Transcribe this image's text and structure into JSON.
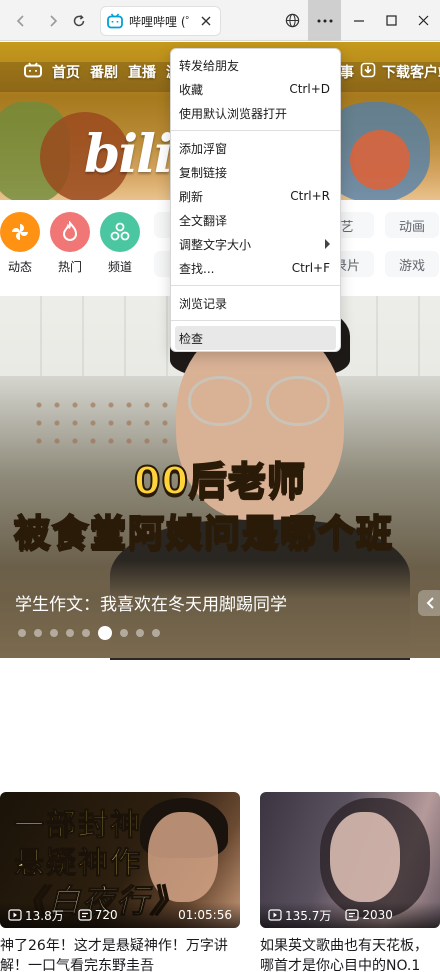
{
  "browser": {
    "tab_title": "哔哩哔哩 (゜-゜)つロ",
    "brand_color": "#00a1d6",
    "back_icon": "back-arrow-icon",
    "forward_icon": "forward-arrow-icon",
    "reload_icon": "reload-icon",
    "close_icon": "close-icon",
    "globe_icon": "globe-icon",
    "more_icon": "more-dots-icon",
    "min_icon": "minimize-icon",
    "max_icon": "maximize-icon",
    "window_close_icon": "window-close-icon"
  },
  "top_nav": {
    "items": [
      "首页",
      "番剧",
      "直播",
      "游"
    ],
    "right_partial": "事",
    "download_label": "下载客户端"
  },
  "categories": [
    {
      "label": "动态",
      "color": "#ff9212",
      "icon": "pinwheel-icon"
    },
    {
      "label": "热门",
      "color": "#f07775",
      "icon": "flame-icon"
    },
    {
      "label": "频道",
      "color": "#4ac6a0",
      "icon": "channel-icon"
    }
  ],
  "pills": {
    "row1": [
      "艺",
      "动画"
    ],
    "row2": [
      "录片",
      "游戏"
    ]
  },
  "hero": {
    "caption_line1": "00后老师",
    "caption_line2": "被食堂阿姨问是哪个班",
    "title": "学生作文：我喜欢在冬天用脚踢同学",
    "dot_count": 9,
    "active_dot": 5
  },
  "videos": [
    {
      "poster_lines": [
        "一部封神",
        "悬疑神作",
        "《白夜行》"
      ],
      "views": "13.8万",
      "danmaku": "720",
      "duration": "01:05:56",
      "title": "神了26年！这才是悬疑神作！万字讲解！一口气看完东野圭吾"
    },
    {
      "views": "135.7万",
      "danmaku": "2030",
      "duration": "",
      "title": "如果英文歌曲也有天花板，哪首才是你心目中的NO.1"
    }
  ],
  "context_menu": {
    "items": [
      {
        "label": "转发给朋友",
        "shortcut": ""
      },
      {
        "label": "收藏",
        "shortcut": "Ctrl+D"
      },
      {
        "label": "使用默认浏览器打开",
        "shortcut": ""
      },
      {
        "sep": true
      },
      {
        "label": "添加浮窗",
        "shortcut": ""
      },
      {
        "label": "复制链接",
        "shortcut": ""
      },
      {
        "label": "刷新",
        "shortcut": "Ctrl+R"
      },
      {
        "label": "全文翻译",
        "shortcut": ""
      },
      {
        "label": "调整文字大小",
        "shortcut": "",
        "submenu": true
      },
      {
        "label": "查找...",
        "shortcut": "Ctrl+F"
      },
      {
        "sep": true
      },
      {
        "label": "浏览记录",
        "shortcut": ""
      },
      {
        "sep": true
      },
      {
        "label": "检查",
        "shortcut": "",
        "highlighted": true
      }
    ]
  }
}
